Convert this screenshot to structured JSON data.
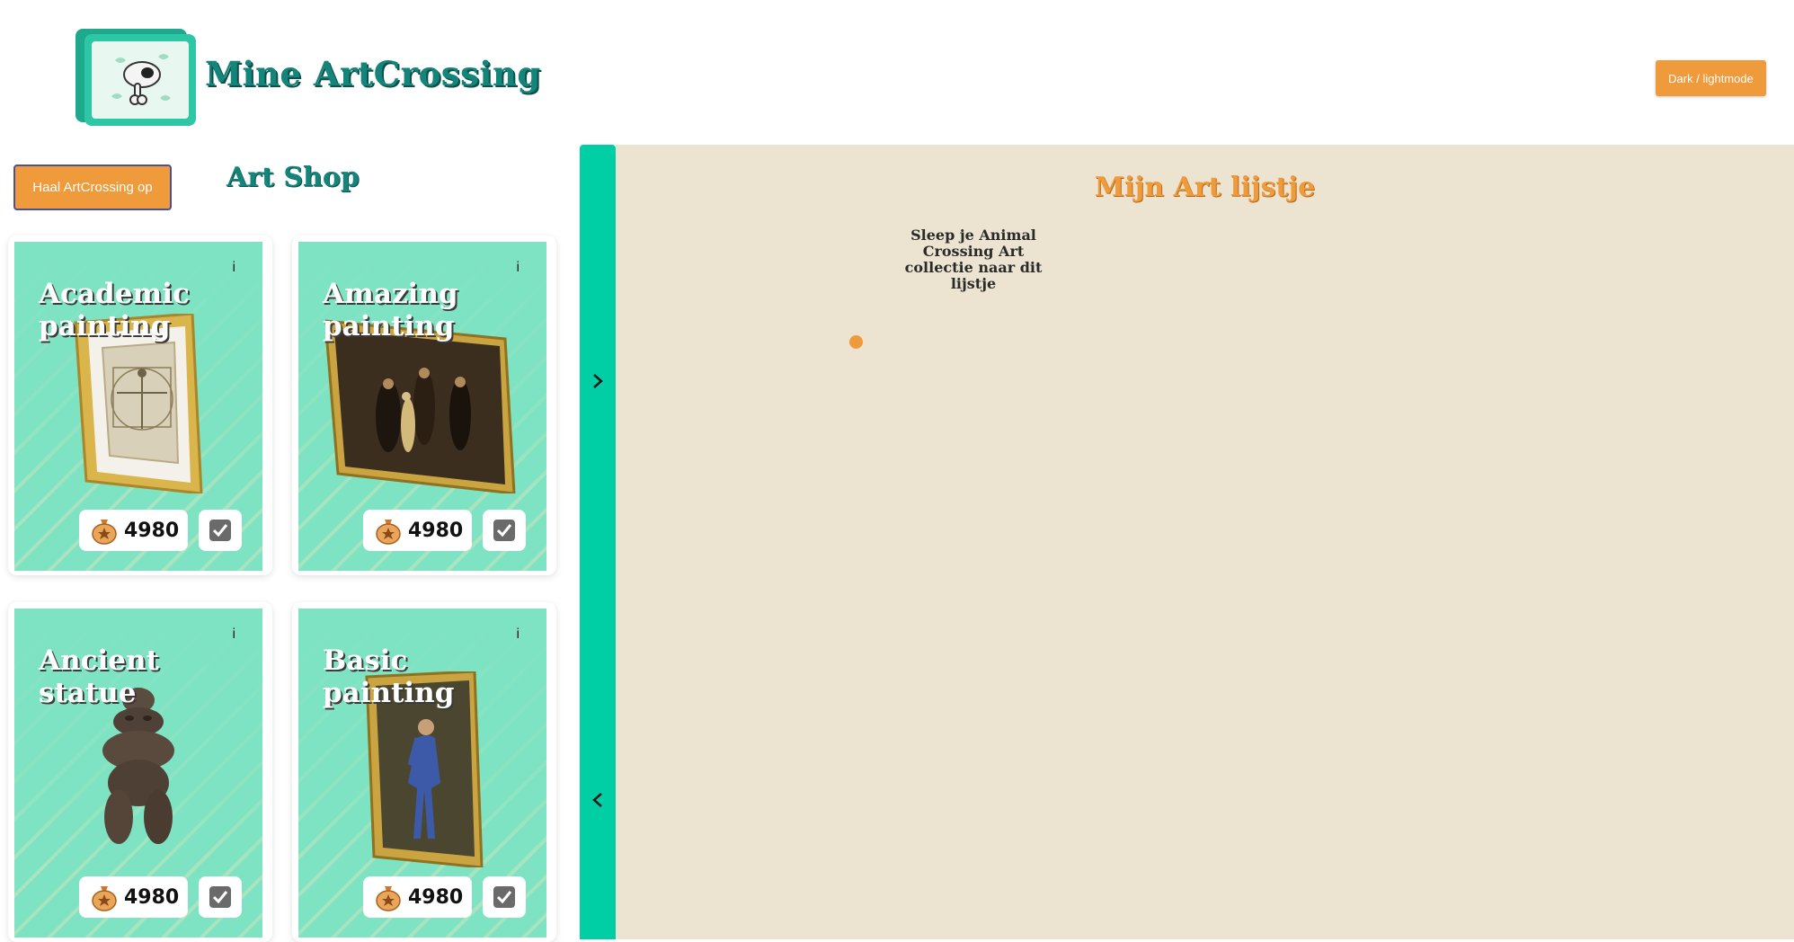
{
  "header": {
    "app_title": "Mine ArtCrossing",
    "theme_toggle_label": "Dark / lightmode"
  },
  "shop": {
    "fetch_button_label": "Haal ArtCrossing op",
    "title": "Art Shop",
    "items": [
      {
        "name": "Academic painting",
        "info": "i",
        "price": "4980"
      },
      {
        "name": "Amazing painting",
        "info": "i",
        "price": "4980"
      },
      {
        "name": "Ancient statue",
        "info": "i",
        "price": "4980"
      },
      {
        "name": "Basic painting",
        "info": "i",
        "price": "4980"
      }
    ]
  },
  "list": {
    "title": "Mijn Art lijstje",
    "hint": "Sleep je Animal Crossing Art collectie naar dit lijstje"
  },
  "icons": {
    "logo": "fossil-logo-icon",
    "price": "bell-bag-icon",
    "check": "checkbox-checked-icon",
    "expand": "chevron-right-icon",
    "collapse": "chevron-left-icon"
  },
  "colors": {
    "accent": "#ef9a3b",
    "brand": "#13857a",
    "sidebar": "#00cfa5",
    "list_bg": "#ece4d1",
    "card": "#7de3c2"
  }
}
